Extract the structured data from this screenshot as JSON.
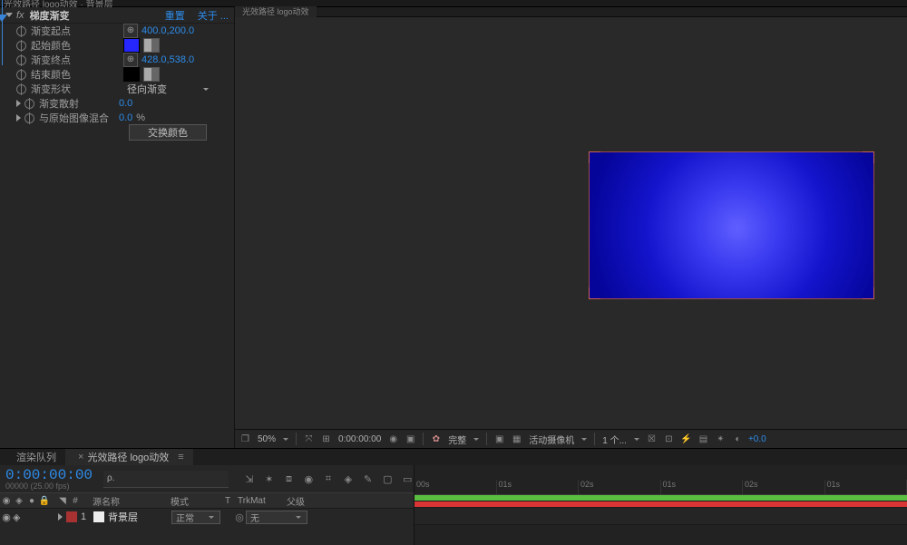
{
  "top_breadcrumb": "光效路径 logo动效 · 背景层",
  "effect": {
    "name": "梯度渐变",
    "reset": "重置",
    "about": "关于 ...",
    "props": {
      "start_point": {
        "label": "渐变起点",
        "value": "400.0,200.0"
      },
      "start_color": {
        "label": "起始颜色"
      },
      "end_point": {
        "label": "渐变终点",
        "value": "428.0,538.0"
      },
      "end_color": {
        "label": "结束颜色"
      },
      "shape": {
        "label": "渐变形状",
        "value": "径向渐变"
      },
      "scatter": {
        "label": "渐变散射",
        "value": "0.0"
      },
      "blend": {
        "label": "与原始图像混合",
        "value": "0.0",
        "unit": "%"
      },
      "swap": "交换颜色"
    }
  },
  "comp_tab": "光效路径 logo动效",
  "footer": {
    "zoom": "50%",
    "time": "0:00:00:00",
    "res": "完整",
    "camera": "活动摄像机",
    "views": "1 个...",
    "exposure": "+0.0"
  },
  "tl": {
    "tabs": {
      "render": "渲染队列",
      "comp": "光效路径 logo动效"
    },
    "timecode": "0:00:00:00",
    "frames": "00000 (25.00 fps)",
    "search_placeholder": "",
    "headers": {
      "source": "源名称",
      "mode": "模式",
      "trk": "TrkMat",
      "parent": "父级",
      "t": "T"
    },
    "layer": {
      "idx": "1",
      "name": "背景层",
      "mode": "正常",
      "trk": "无"
    },
    "ruler": [
      "00s",
      "01s",
      "02s",
      "01s",
      "02s",
      "01s"
    ]
  }
}
